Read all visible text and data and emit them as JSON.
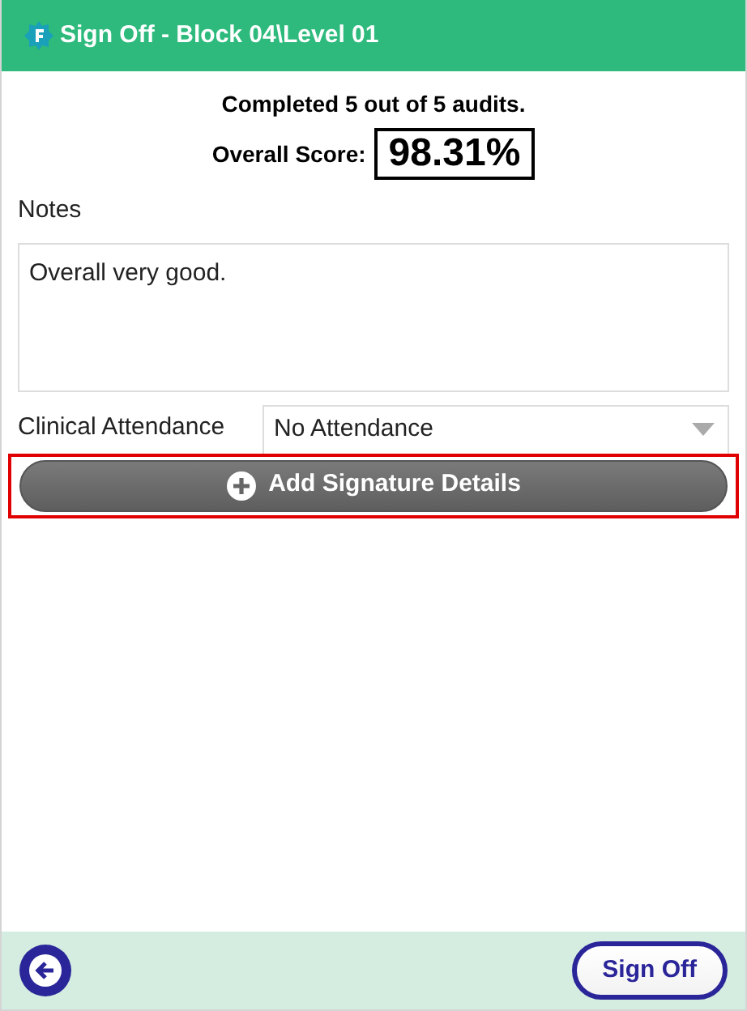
{
  "header": {
    "title": "Sign Off - Block 04\\Level 01"
  },
  "summary": {
    "completed": "Completed 5 out of 5 audits.",
    "score_label": "Overall Score:",
    "score": "98.31%"
  },
  "notes": {
    "label": "Notes",
    "value": "Overall very good."
  },
  "attendance": {
    "label": "Clinical Attendance",
    "value": "No Attendance"
  },
  "signature_button": {
    "label": "Add Signature Details",
    "focused": true
  },
  "footer": {
    "sign_off_button": "Sign Off"
  }
}
